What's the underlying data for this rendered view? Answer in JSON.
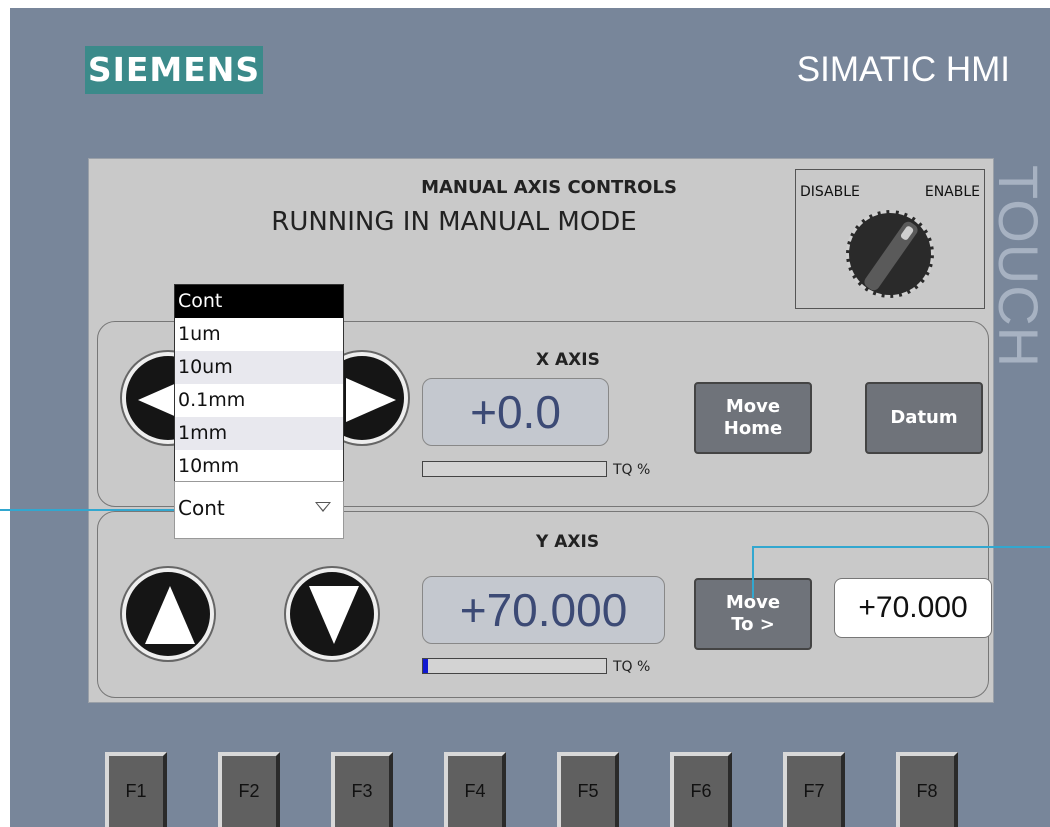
{
  "brand": {
    "logo_text": "SIEMENS",
    "product": "SIMATIC HMI",
    "side_label": "TOUCH"
  },
  "panel": {
    "title": "MANUAL AXIS CONTROLS",
    "mode": "RUNNING IN MANUAL MODE"
  },
  "key_switch": {
    "disable": "DISABLE",
    "enable": "ENABLE"
  },
  "x_axis": {
    "title": "X AXIS",
    "value": "+0.0",
    "tq_label": "TQ %",
    "tq_fraction": 0,
    "move_home_line1": "Move",
    "move_home_line2": "Home",
    "datum": "Datum"
  },
  "y_axis": {
    "title": "Y AXIS",
    "value": "+70.000",
    "tq_label": "TQ %",
    "tq_fraction": 0.03,
    "move_to_line1": "Move",
    "move_to_line2": "To >",
    "target": "+70.000"
  },
  "step_dropdown": {
    "options": [
      "Cont",
      "1um",
      "10um",
      "0.1mm",
      "1mm",
      "10mm"
    ],
    "selected": "Cont"
  },
  "fkeys": [
    "F1",
    "F2",
    "F3",
    "F4",
    "F5",
    "F6",
    "F7",
    "F8"
  ],
  "colors": {
    "bezel": "#78869a",
    "screen": "#c9c9c9",
    "logo": "#3b8a8a",
    "value_text": "#3c4a75",
    "tq_fill": "#1018d0",
    "callout": "#32a7cf"
  }
}
